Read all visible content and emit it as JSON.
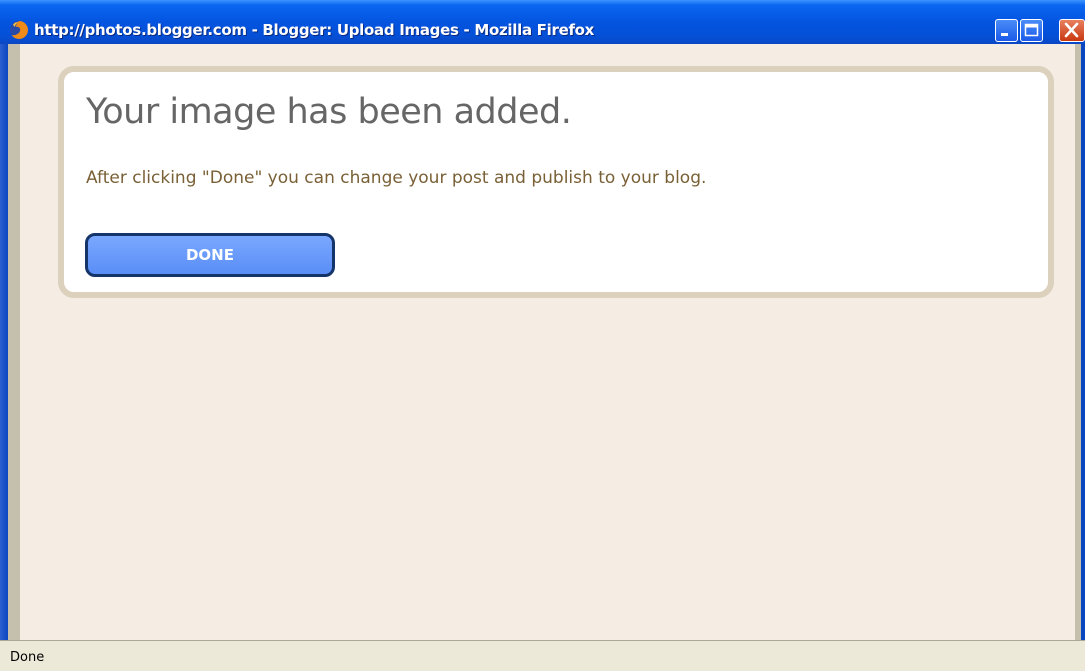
{
  "window": {
    "title": "http://photos.blogger.com - Blogger: Upload Images - Mozilla Firefox",
    "icon": "firefox-icon",
    "controls": {
      "minimize": "minimize-icon",
      "maximize": "maximize-icon",
      "close": "close-icon"
    }
  },
  "card": {
    "title": "Your image has been added.",
    "message": "After clicking \"Done\" you can change your post and publish to your blog.",
    "button_label": "DONE"
  },
  "status": {
    "text": "Done"
  },
  "colors": {
    "titlebar": "#0454e0",
    "page_bg": "#f5ede4",
    "card_border": "#dcd1bd",
    "title_text": "#666666",
    "message_text": "#7a6036",
    "button_fill": "#6a9bff",
    "button_border": "#15346a"
  }
}
